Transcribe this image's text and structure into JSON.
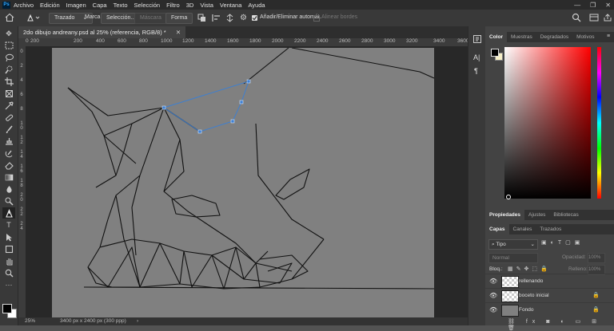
{
  "menu": {
    "logo": "Ps",
    "items": [
      "Archivo",
      "Edición",
      "Imagen",
      "Capa",
      "Texto",
      "Selección",
      "Filtro",
      "3D",
      "Vista",
      "Ventana",
      "Ayuda"
    ],
    "window_controls": [
      "—",
      "❐",
      "✕"
    ]
  },
  "options": {
    "mode_value": "Trazado",
    "marca_label": "Marca:",
    "seleccion_button": "Selección...",
    "mascara_button": "Máscara",
    "forma_button": "Forma",
    "auto_add_label": "Añadir/Eliminar automát.",
    "align_edges_label": "Alinear bordes"
  },
  "document": {
    "tab_title": "2do dibujo andreany.psd al 25% (referencia, RGB/8) *",
    "ruler_h": [
      "200",
      "0",
      "200",
      "400",
      "600",
      "800",
      "1000",
      "1200",
      "1400",
      "1600",
      "1800",
      "2000",
      "2200",
      "2400",
      "2600",
      "2800",
      "3000",
      "3200",
      "3400",
      "3600"
    ],
    "ruler_v": [
      "0",
      "2",
      "4",
      "6",
      "8",
      "1",
      "0",
      "1",
      "2",
      "1",
      "4",
      "1",
      "6",
      "1",
      "8",
      "2",
      "0",
      "2",
      "2",
      "2",
      "4"
    ]
  },
  "status": {
    "zoom": "25%",
    "doc_size": "3400 px x 2400 px (300 ppp)"
  },
  "panels": {
    "color_tabs": [
      "Color",
      "Muestras",
      "Degradados",
      "Motivos"
    ],
    "props_tabs": [
      "Propiedades",
      "Ajustes",
      "Bibliotecas"
    ],
    "layers_tabs": [
      "Capas",
      "Canales",
      "Trazados"
    ],
    "filter_value": "Tipo",
    "blend_mode": "Normal",
    "opacity_label": "Opacidad:",
    "opacity_value": "100%",
    "lock_label": "Bloq.:",
    "fill_label": "Relleno:",
    "fill_value": "100%",
    "layers": [
      {
        "name": "rellenando"
      },
      {
        "name": "boceto inicial"
      },
      {
        "name": "Fondo"
      }
    ]
  },
  "colors": {
    "accent": "#31a8ff",
    "path_color": "#3d7fd1",
    "canvas_bg": "#808080"
  }
}
